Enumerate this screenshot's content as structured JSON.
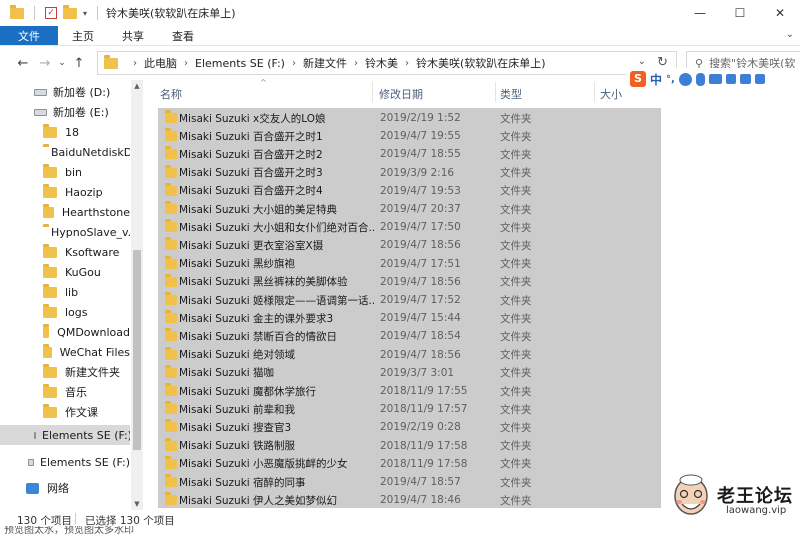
{
  "window": {
    "title": "铃木美咲(软软趴在床单上)",
    "controls": [
      "—",
      "☐",
      "✕"
    ]
  },
  "ribbon": {
    "tabs": [
      "文件",
      "主页",
      "共享",
      "查看"
    ]
  },
  "address": {
    "crumbs": [
      "此电脑",
      "Elements SE (F:)",
      "新建文件",
      "铃木美",
      "铃木美咲(软软趴在床单上)"
    ],
    "search_placeholder": "搜索\"铃木美咲(软"
  },
  "sidebar": {
    "items": [
      {
        "label": "新加卷 (D:)",
        "kind": "drive"
      },
      {
        "label": "新加卷 (E:)",
        "kind": "drive"
      },
      {
        "label": "18",
        "kind": "folder"
      },
      {
        "label": "BaiduNetdiskD",
        "kind": "folder"
      },
      {
        "label": "bin",
        "kind": "folder"
      },
      {
        "label": "Haozip",
        "kind": "folder"
      },
      {
        "label": "Hearthstone",
        "kind": "folder"
      },
      {
        "label": "HypnoSlave_v.",
        "kind": "folder"
      },
      {
        "label": "Ksoftware",
        "kind": "folder"
      },
      {
        "label": "KuGou",
        "kind": "folder"
      },
      {
        "label": "lib",
        "kind": "folder"
      },
      {
        "label": "logs",
        "kind": "folder"
      },
      {
        "label": "QMDownload",
        "kind": "folder"
      },
      {
        "label": "WeChat Files",
        "kind": "folder"
      },
      {
        "label": "新建文件夹",
        "kind": "folder"
      },
      {
        "label": "音乐",
        "kind": "folder"
      },
      {
        "label": "作文课",
        "kind": "folder"
      },
      {
        "label": "Elements SE (F:)",
        "kind": "drive",
        "selected": true
      },
      {
        "label": "Elements SE (F:)",
        "kind": "drive"
      },
      {
        "label": "网络",
        "kind": "network"
      }
    ]
  },
  "columns": {
    "name": "名称",
    "date": "修改日期",
    "type": "类型",
    "size": "大小"
  },
  "files": [
    {
      "name": "Misaki Suzuki x交友人的LO娘",
      "date": "2019/2/19 1:52",
      "type": "文件夹"
    },
    {
      "name": "Misaki Suzuki 百合盛开之时1",
      "date": "2019/4/7 19:55",
      "type": "文件夹"
    },
    {
      "name": "Misaki Suzuki 百合盛开之时2",
      "date": "2019/4/7 18:55",
      "type": "文件夹"
    },
    {
      "name": "Misaki Suzuki 百合盛开之时3",
      "date": "2019/3/9 2:16",
      "type": "文件夹"
    },
    {
      "name": "Misaki Suzuki 百合盛开之时4",
      "date": "2019/4/7 19:53",
      "type": "文件夹"
    },
    {
      "name": "Misaki Suzuki 大小姐的美足特典",
      "date": "2019/4/7 20:37",
      "type": "文件夹"
    },
    {
      "name": "Misaki Suzuki 大小姐和女仆们绝对百合...",
      "date": "2019/4/7 17:50",
      "type": "文件夹"
    },
    {
      "name": "Misaki Suzuki 更衣室浴室X摄",
      "date": "2019/4/7 18:56",
      "type": "文件夹"
    },
    {
      "name": "Misaki Suzuki 黑纱旗袍",
      "date": "2019/4/7 17:51",
      "type": "文件夹"
    },
    {
      "name": "Misaki Suzuki 黑丝裤袜的美脚体验",
      "date": "2019/4/7 18:56",
      "type": "文件夹"
    },
    {
      "name": "Misaki Suzuki 姬様限定——语调第一话...",
      "date": "2019/4/7 17:52",
      "type": "文件夹"
    },
    {
      "name": "Misaki Suzuki 金主的课外要求3",
      "date": "2019/4/7 15:44",
      "type": "文件夹"
    },
    {
      "name": "Misaki Suzuki 禁断百合的情欲日",
      "date": "2019/4/7 18:54",
      "type": "文件夹"
    },
    {
      "name": "Misaki Suzuki 绝对领域",
      "date": "2019/4/7 18:56",
      "type": "文件夹"
    },
    {
      "name": "Misaki Suzuki 猫咖",
      "date": "2019/3/7 3:01",
      "type": "文件夹"
    },
    {
      "name": "Misaki Suzuki 魔都休学旅行",
      "date": "2018/11/9 17:55",
      "type": "文件夹"
    },
    {
      "name": "Misaki Suzuki 前辈和我",
      "date": "2018/11/9 17:57",
      "type": "文件夹"
    },
    {
      "name": "Misaki Suzuki 搜查官3",
      "date": "2019/2/19 0:28",
      "type": "文件夹"
    },
    {
      "name": "Misaki Suzuki 铁路制服",
      "date": "2018/11/9 17:58",
      "type": "文件夹"
    },
    {
      "name": "Misaki Suzuki 小恶魔版挑衅的少女",
      "date": "2018/11/9 17:58",
      "type": "文件夹"
    },
    {
      "name": "Misaki Suzuki 宿醉的同事",
      "date": "2019/4/7 18:57",
      "type": "文件夹"
    },
    {
      "name": "Misaki Suzuki 伊人之美如梦似幻",
      "date": "2019/4/7 18:46",
      "type": "文件夹"
    }
  ],
  "status": {
    "count": "130 个项目",
    "selected": "已选择 130 个项目"
  },
  "bottom_text": "预览图太水，预览图太多水印",
  "ime": {
    "logo": "S",
    "mode": "中",
    "punct": "°,"
  },
  "watermark": {
    "title": "老王论坛",
    "url": "laowang.vip"
  },
  "colors": {
    "file_tab": "#1a6fc2",
    "selection": "#cccccc",
    "folder": "#f0c14b"
  }
}
